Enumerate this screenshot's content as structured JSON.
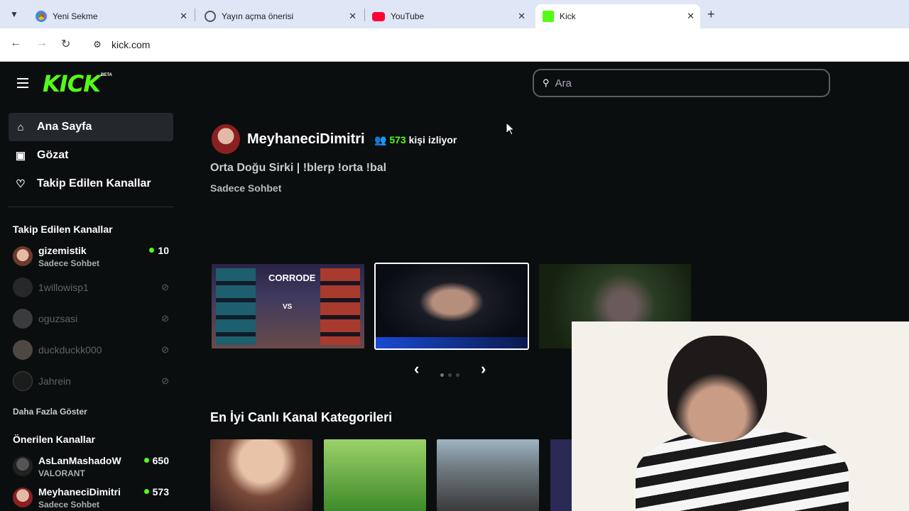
{
  "browser": {
    "tabs": [
      {
        "label": "Yeni Sekme",
        "icon": "chrome-icon"
      },
      {
        "label": "Yayın açma önerisi",
        "icon": "openai-icon"
      },
      {
        "label": "YouTube",
        "icon": "youtube-icon"
      },
      {
        "label": "Kick",
        "icon": "kick-icon",
        "active": true
      }
    ],
    "url": "kick.com"
  },
  "header": {
    "logo": "KICK",
    "logo_badge": "BETA",
    "search_placeholder": "Ara"
  },
  "sidebar": {
    "nav": [
      {
        "label": "Ana Sayfa",
        "icon": "home-icon",
        "active": true
      },
      {
        "label": "Gözat",
        "icon": "browse-icon"
      },
      {
        "label": "Takip Edilen Kanallar",
        "icon": "heart-icon"
      }
    ],
    "followed_title": "Takip Edilen Kanallar",
    "followed": [
      {
        "name": "gizemistik",
        "category": "Sadece Sohbet",
        "viewers": "10",
        "live": true
      },
      {
        "name": "1willowisp1",
        "live": false
      },
      {
        "name": "oguzsasi",
        "live": false
      },
      {
        "name": "duckduckk000",
        "live": false
      },
      {
        "name": "Jahrein",
        "live": false
      }
    ],
    "show_more": "Daha Fazla Göster",
    "recommended_title": "Önerilen Kanallar",
    "recommended": [
      {
        "name": "AsLanMashadoW",
        "category": "VALORANT",
        "viewers": "650"
      },
      {
        "name": "MeyhaneciDimitri",
        "category": "Sadece Sohbet",
        "viewers": "573"
      }
    ]
  },
  "featured": {
    "streamer": "MeyhaneciDimitri",
    "viewer_count": "573",
    "viewer_suffix": "kişi izliyor",
    "title": "Orta Doğu Sirki | !blerp !orta !bal",
    "category": "Sadece Sohbet",
    "thumb_label": "CORRODE",
    "thumb_vs": "VS"
  },
  "categories_title": "En İyi Canlı Kanal Kategorileri",
  "colors": {
    "accent": "#53fc18",
    "bg": "#0b0e0f"
  }
}
